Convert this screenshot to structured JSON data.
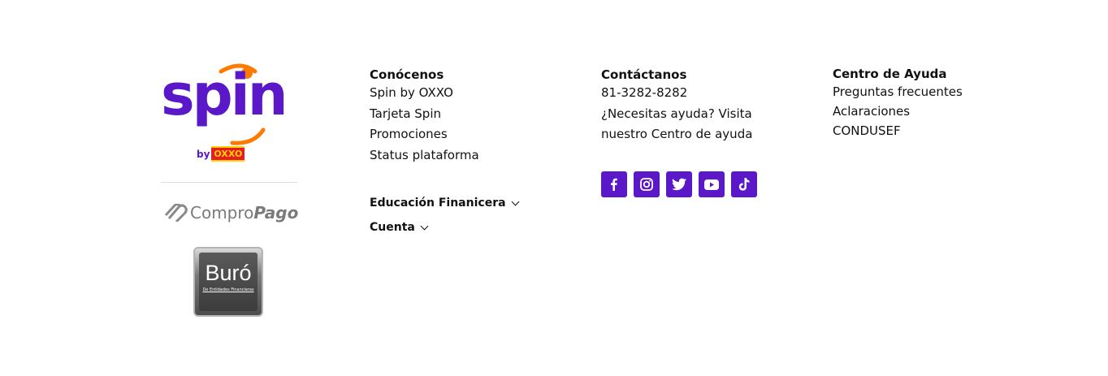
{
  "brand": {
    "logo_text": "spin",
    "by_text": "by",
    "oxxo_text": "OXXO",
    "compro": "Compro",
    "pago": "Pago",
    "buro_title": "Buró",
    "buro_sub": "De Entidades Financieras",
    "colors": {
      "purple": "#5b18c9",
      "orange": "#ff7a00",
      "oxxo_red": "#e81c24",
      "oxxo_yellow": "#ffd200"
    }
  },
  "conocenos": {
    "title": "Conócenos",
    "links": [
      "Spin by OXXO",
      "Tarjeta Spin",
      "Promociones",
      "Status plataforma"
    ]
  },
  "accordions": [
    {
      "label": "Educación Finanicera",
      "icon": "chevron-down-icon"
    },
    {
      "label": "Cuenta",
      "icon": "chevron-down-icon"
    }
  ],
  "contacto": {
    "title": "Contáctanos",
    "phone": "81-3282-8282",
    "help_line1": "¿Necesitas ayuda? Visita",
    "help_line2": "nuestro Centro de ayuda"
  },
  "social": [
    "facebook-icon",
    "instagram-icon",
    "twitter-icon",
    "youtube-icon",
    "tiktok-icon"
  ],
  "ayuda": {
    "title": "Centro de Ayuda",
    "links": [
      "Preguntas frecuentes",
      "Aclaraciones",
      "CONDUSEF"
    ]
  }
}
